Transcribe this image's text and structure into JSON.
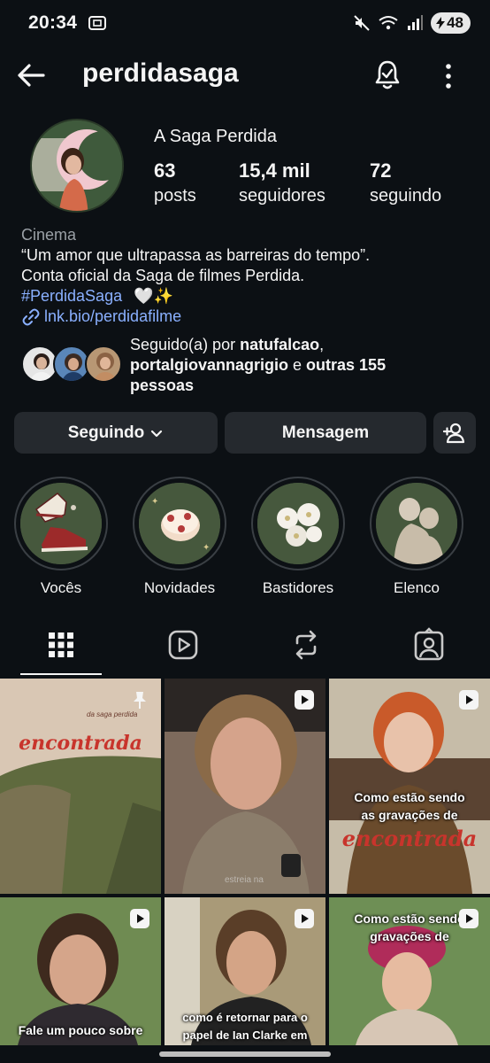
{
  "status_bar": {
    "time": "20:34",
    "battery": "48"
  },
  "header": {
    "username": "perdidasaga"
  },
  "profile": {
    "display_name": "A Saga Perdida",
    "stats": [
      {
        "value": "63",
        "label": "posts"
      },
      {
        "value": "15,4 mil",
        "label": "seguidores"
      },
      {
        "value": "72",
        "label": "seguindo"
      }
    ],
    "category": "Cinema",
    "bio_line1": "“Um amor que ultrapassa as barreiras do tempo”.",
    "bio_line2": "Conta oficial da Saga de filmes Perdida.",
    "hashtag": "#PerdidaSaga",
    "emojis": "🤍✨",
    "link": "lnk.bio/perdidafilme",
    "followed_prefix": "Seguido(a) por ",
    "followed_user1": "natufalcao",
    "followed_sep": ",",
    "followed_user2": "portalgiovannagrigio",
    "followed_mid": " e ",
    "followed_more": "outras 155",
    "followed_suffix": "pessoas"
  },
  "buttons": {
    "following": "Seguindo",
    "message": "Mensagem"
  },
  "highlights": [
    {
      "label": "Vocês"
    },
    {
      "label": "Novidades"
    },
    {
      "label": "Bastidores"
    },
    {
      "label": "Elenco"
    }
  ],
  "posts": [
    {
      "small_text": "da saga perdida",
      "title": "encontrada",
      "type": "pinned"
    },
    {
      "small_text": "estreia na",
      "type": "reel"
    },
    {
      "caption1": "Como estão sendo",
      "caption2": "as gravações de",
      "title": "encontrada",
      "type": "reel"
    },
    {
      "caption1": "Fale um pouco sobre",
      "type": "reel"
    },
    {
      "caption1": "como é retornar para o",
      "caption2": "papel de Ian Clarke em",
      "type": "reel"
    },
    {
      "caption1": "Como estão sendo",
      "caption2": "gravações de",
      "type": "reel"
    }
  ],
  "colors": {
    "background": "#0c1014",
    "button": "#25292e",
    "link": "#8ab0ff",
    "highlight_bg": "#46583d"
  }
}
